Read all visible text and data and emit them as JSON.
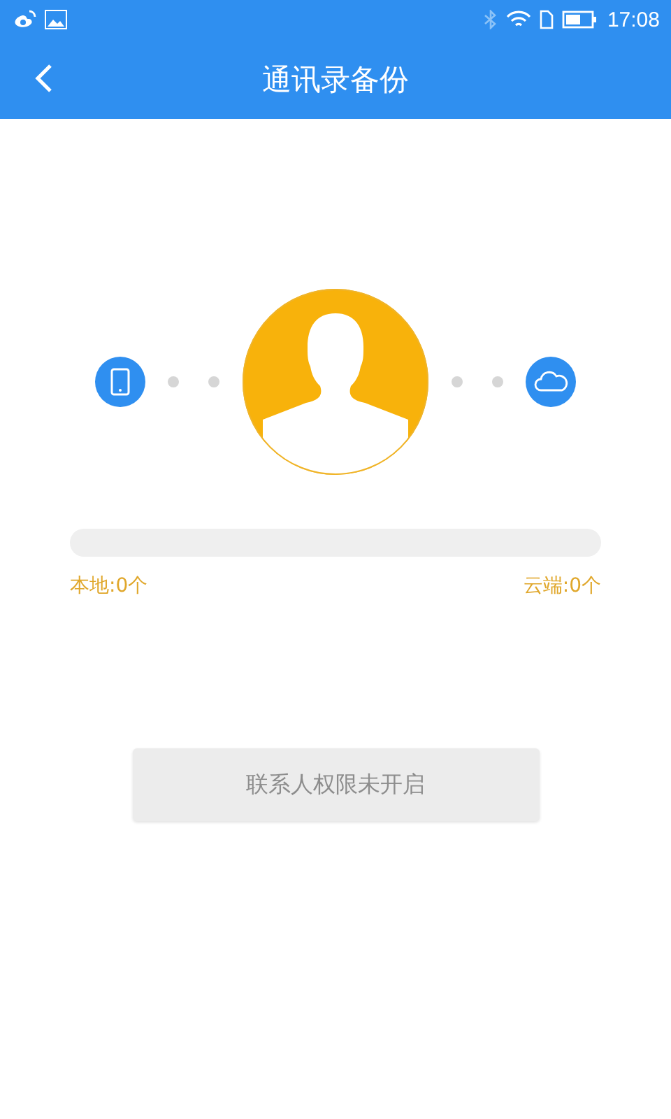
{
  "status_bar": {
    "time": "17:08"
  },
  "header": {
    "title": "通讯录备份"
  },
  "progress": {
    "level": 0
  },
  "counts": {
    "local": "本地:0个",
    "cloud": "云端:0个"
  },
  "action_button": {
    "label": "联系人权限未开启",
    "disabled": true
  }
}
